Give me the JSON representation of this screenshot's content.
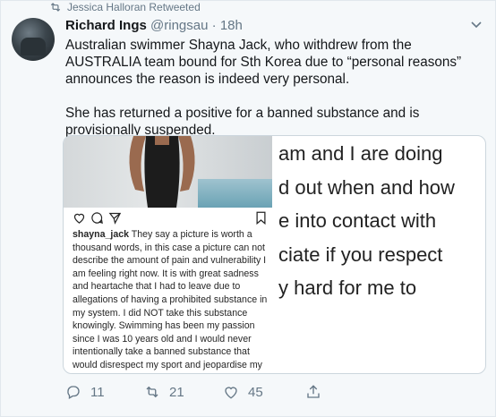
{
  "retweet_notice": "Jessica Halloran Retweeted",
  "author": {
    "name": "Richard Ings",
    "handle": "@ringsau",
    "separator": "·",
    "time": "18h"
  },
  "tweet": {
    "paragraph1": "Australian swimmer Shayna Jack, who withdrew from the AUSTRALIA team bound for Sth Korea due to “personal reasons” announces the reason is indeed very personal.",
    "paragraph2": "She has returned a positive for a banned substance and is provisionally suspended."
  },
  "media": {
    "ig_caption_user": "shayna_jack",
    "ig_caption_text": " They say a picture is worth a thousand words, in this case a picture can not describe the amount of pain and vulnerability I am feeling right now. It is with great sadness and heartache that I had to leave due to allegations of having a prohibited substance in my system. I did NOT take this substance knowingly. Swimming has been my passion since I was 10 years old and I would never intentionally take a banned substance that would disrespect my sport and jeopardise my",
    "big_text_lines": [
      "am and I are doing",
      "d out when and how",
      "e into contact with",
      "ciate if you respect",
      "y hard for me to"
    ]
  },
  "actions": {
    "replies": "11",
    "retweets": "21",
    "likes": "45"
  },
  "icons": [
    "retweet-icon",
    "avatar",
    "chevron-down-icon",
    "heart-icon",
    "comment-icon",
    "send-icon",
    "bookmark-icon",
    "reply-icon",
    "like-icon",
    "share-icon"
  ],
  "colors": {
    "secondary_text": "#657786",
    "background": "#f5f8fa",
    "border": "#e1e8ed"
  }
}
